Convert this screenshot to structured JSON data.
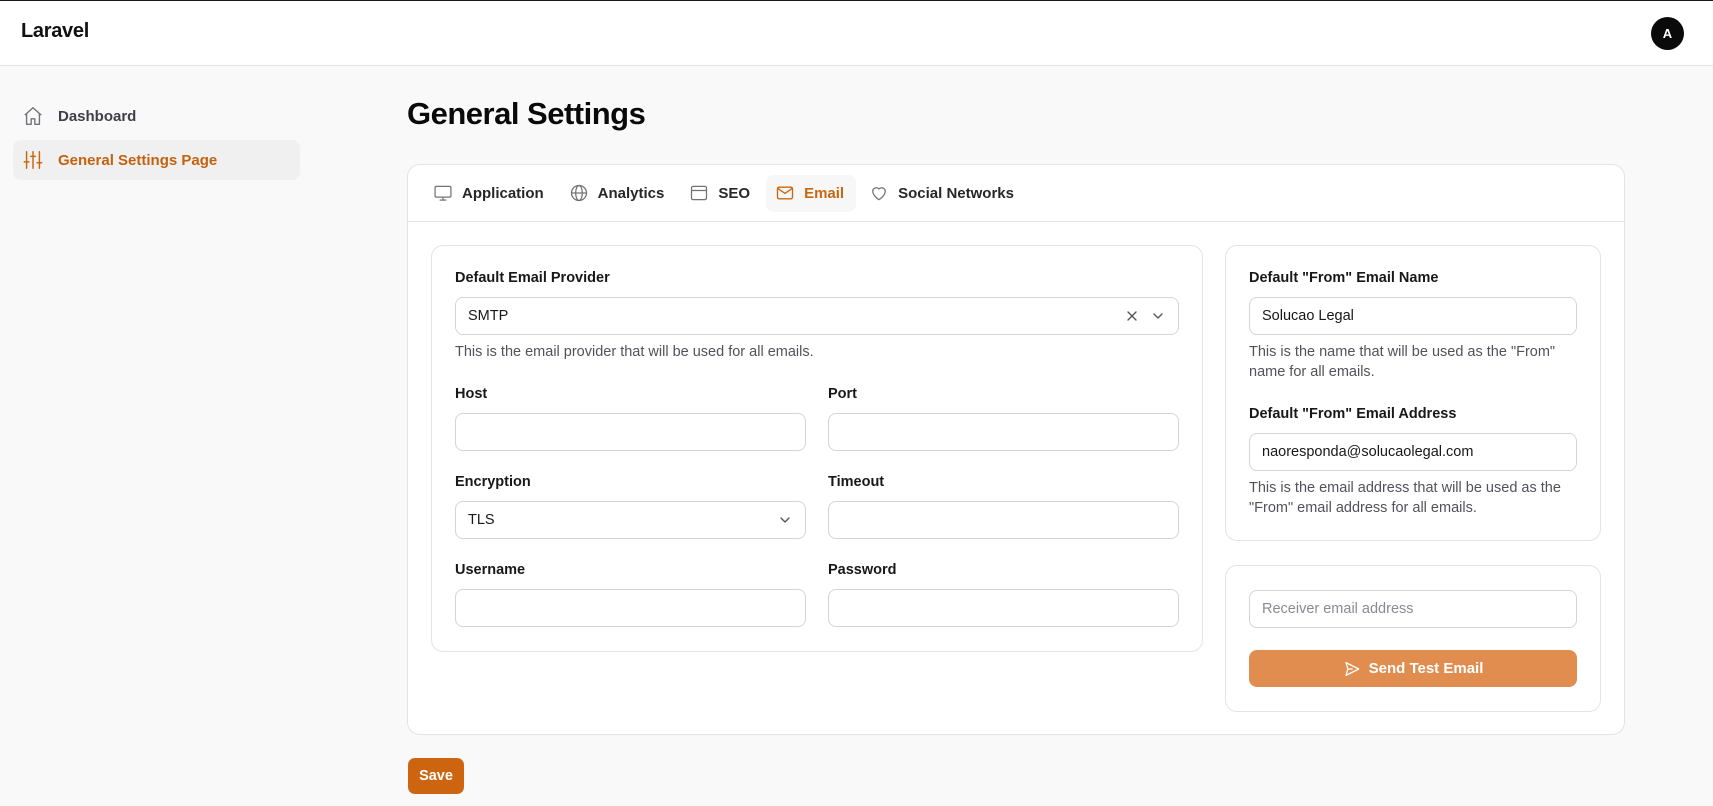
{
  "header": {
    "brand": "Laravel",
    "avatar_initial": "A"
  },
  "sidebar": {
    "items": [
      {
        "label": "Dashboard",
        "icon": "home-icon",
        "active": false
      },
      {
        "label": "General Settings Page",
        "icon": "sliders-icon",
        "active": true
      }
    ]
  },
  "main": {
    "title": "General Settings",
    "tabs": [
      {
        "label": "Application",
        "icon": "monitor-icon"
      },
      {
        "label": "Analytics",
        "icon": "globe-icon"
      },
      {
        "label": "SEO",
        "icon": "window-icon"
      },
      {
        "label": "Email",
        "icon": "envelope-icon",
        "active": true
      },
      {
        "label": "Social Networks",
        "icon": "heart-icon"
      }
    ],
    "email": {
      "provider_label": "Default Email Provider",
      "provider_value": "SMTP",
      "provider_help": "This is the email provider that will be used for all emails.",
      "host_label": "Host",
      "host_value": "",
      "port_label": "Port",
      "port_value": "",
      "encryption_label": "Encryption",
      "encryption_value": "TLS",
      "timeout_label": "Timeout",
      "timeout_value": "",
      "username_label": "Username",
      "username_value": "",
      "password_label": "Password",
      "password_value": "",
      "from_name_label": "Default \"From\" Email Name",
      "from_name_value": "Solucao Legal",
      "from_name_help": "This is the name that will be used as the \"From\" name for all emails.",
      "from_address_label": "Default \"From\" Email Address",
      "from_address_value": "naoresponda@solucaolegal.com",
      "from_address_help": "This is the email address that will be used as the \"From\" email address for all emails.",
      "receiver_placeholder": "Receiver email address",
      "send_test_label": "Send Test Email"
    },
    "save_label": "Save"
  },
  "colors": {
    "accent": "#c9670f",
    "send_button": "#e18d4f",
    "save_button": "#cc6410"
  }
}
